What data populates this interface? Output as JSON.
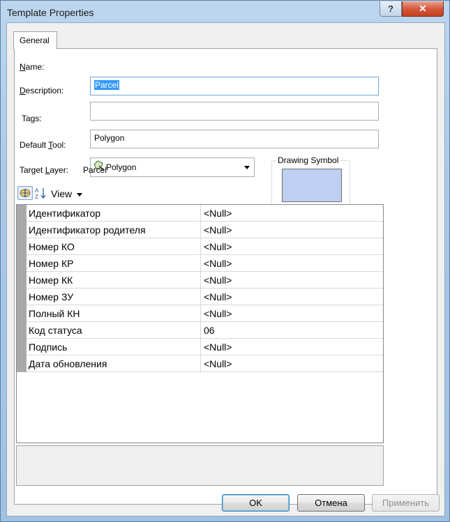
{
  "window": {
    "title": "Template Properties",
    "help_glyph": "?",
    "close_glyph": "✕"
  },
  "tabs": [
    {
      "label": "General"
    }
  ],
  "form": {
    "name": {
      "label": "Name:",
      "value": "Parcel"
    },
    "description": {
      "label": "Description:",
      "value": ""
    },
    "tags": {
      "label": "Tags:",
      "value": "Polygon"
    },
    "default_tool": {
      "label": "Default Tool:",
      "value": "Polygon",
      "icon": "polygon-tool-icon"
    },
    "target_layer": {
      "label": "Target Layer:",
      "value": "Parcel"
    }
  },
  "drawing_symbol": {
    "title": "Drawing Symbol",
    "fill_color": "#bdd0f1"
  },
  "attributes_toolbar": {
    "view_label": "View"
  },
  "attributes": [
    {
      "name": "Идентификатор",
      "value": "<Null>"
    },
    {
      "name": "Идентификатор родителя",
      "value": "<Null>"
    },
    {
      "name": "Номер КО",
      "value": "<Null>"
    },
    {
      "name": "Номер КР",
      "value": "<Null>"
    },
    {
      "name": "Номер КК",
      "value": "<Null>"
    },
    {
      "name": "Номер ЗУ",
      "value": "<Null>"
    },
    {
      "name": "Полный КН",
      "value": "<Null>"
    },
    {
      "name": "Код статуса",
      "value": "06"
    },
    {
      "name": "Подпись",
      "value": "<Null>"
    },
    {
      "name": "Дата обновления",
      "value": "<Null>"
    }
  ],
  "buttons": {
    "ok": "OK",
    "cancel": "Отмена",
    "apply": "Применить"
  }
}
